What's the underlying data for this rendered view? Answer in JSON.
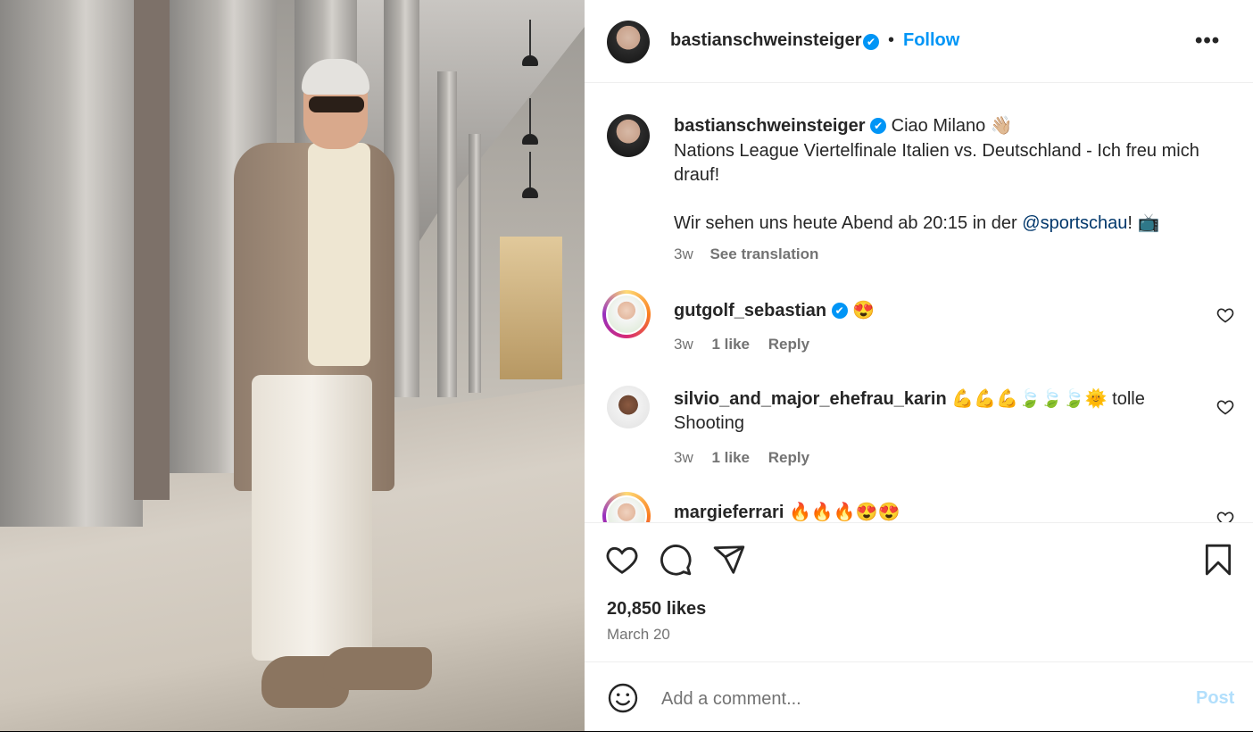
{
  "post": {
    "username": "bastianschweinsteiger",
    "verified_mark": "✔",
    "separator": "•",
    "follow_label": "Follow",
    "more_label": "•••"
  },
  "caption": {
    "username": "bastianschweinsteiger",
    "line1": "Ciao Milano 👋🏼",
    "line2": "Nations League Viertelfinale Italien vs. Deutschland - Ich freu mich drauf!",
    "line3_prefix": "Wir sehen uns heute Abend ab 20:15 in der ",
    "mention": "@sportschau",
    "line3_suffix": "! 📺",
    "time": "3w",
    "see_translation": "See translation"
  },
  "comments": [
    {
      "username": "gutgolf_sebastian",
      "verified": true,
      "text": "😍",
      "time": "3w",
      "likes": "1 like",
      "reply": "Reply"
    },
    {
      "username": "silvio_and_major_ehefrau_karin",
      "verified": false,
      "text": "💪💪💪🍃🍃🍃🌞 tolle Shooting",
      "time": "3w",
      "likes": "1 like",
      "reply": "Reply"
    },
    {
      "username": "margieferrari",
      "verified": false,
      "text": "🔥🔥🔥😍😍"
    }
  ],
  "actions": {
    "likes": "20,850 likes",
    "date": "March 20"
  },
  "composer": {
    "placeholder": "Add a comment...",
    "post_label": "Post"
  },
  "icons": {
    "like": "heart-icon",
    "comment": "speech-bubble-icon",
    "share": "paper-plane-icon",
    "save": "bookmark-icon",
    "emoji": "smiley-icon",
    "more": "ellipsis-icon"
  },
  "colors": {
    "accent": "#0095f6",
    "mention": "#00376b",
    "muted": "#737373",
    "text": "#262626",
    "post_disabled": "#b2dffc"
  }
}
